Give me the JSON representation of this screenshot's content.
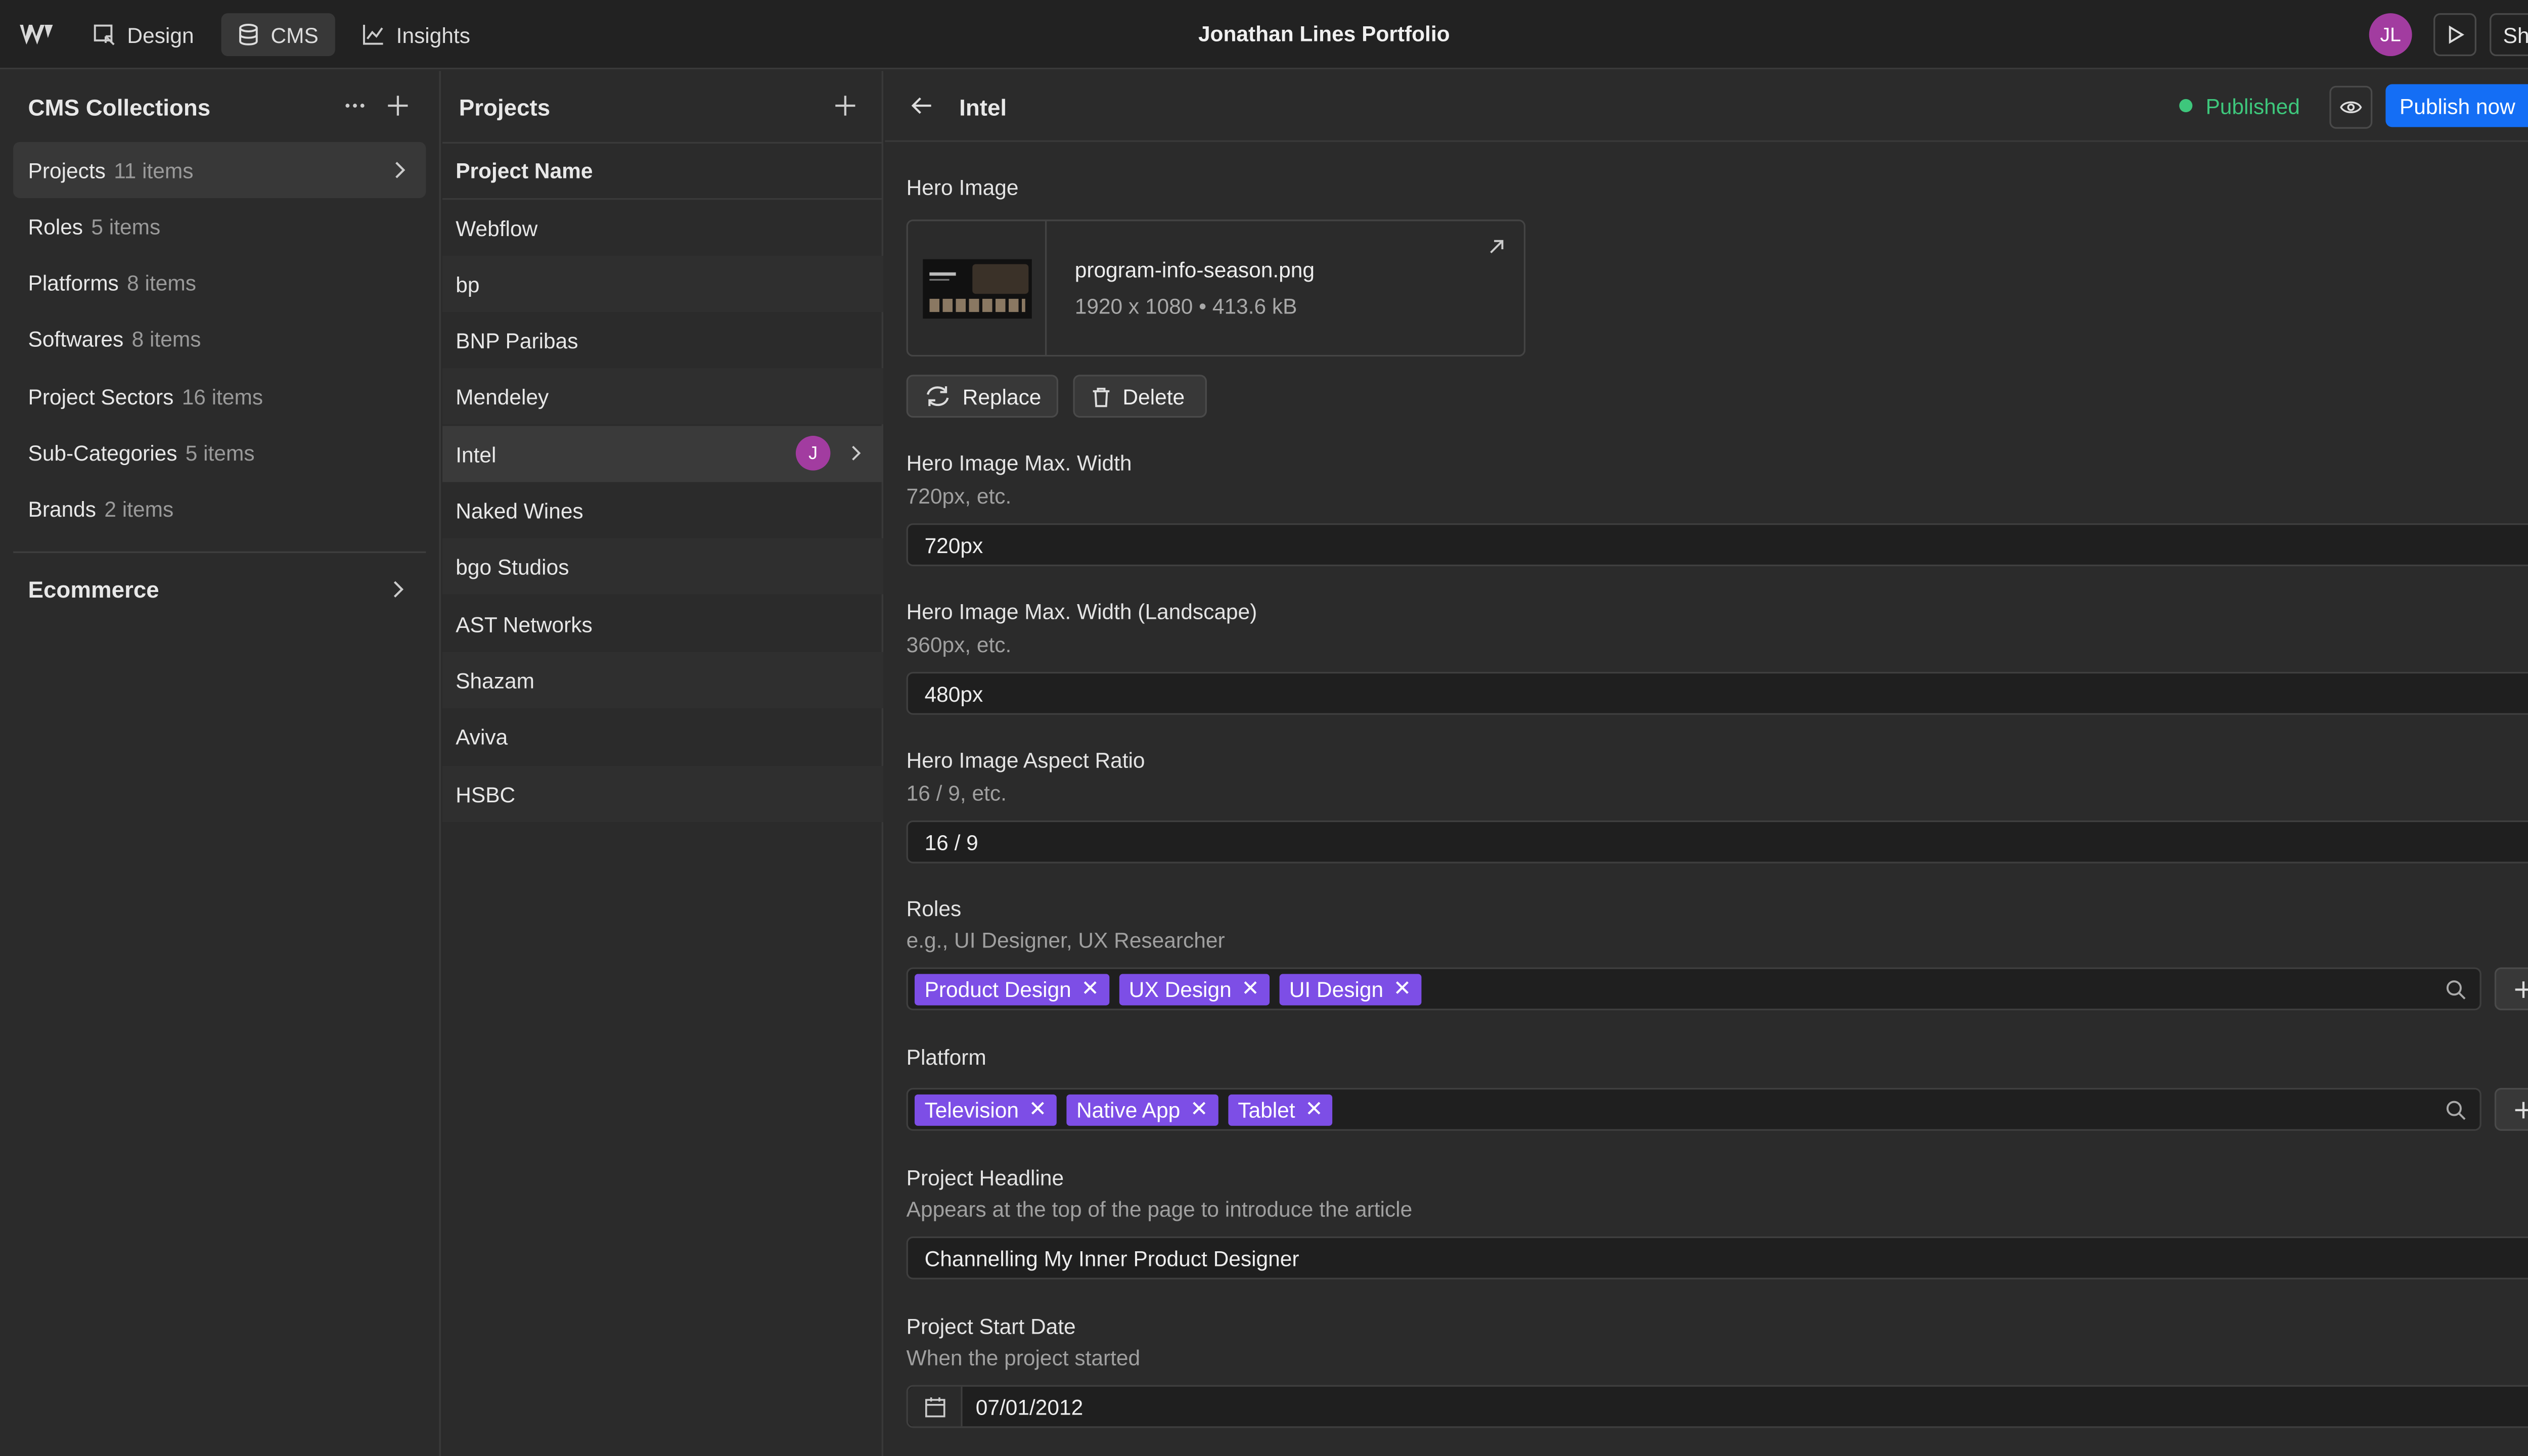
{
  "topbar": {
    "nav": [
      {
        "label": "Design",
        "icon": "design-icon"
      },
      {
        "label": "CMS",
        "icon": "database-icon",
        "active": true
      },
      {
        "label": "Insights",
        "icon": "chart-icon"
      }
    ],
    "project_title": "Jonathan Lines Portfolio",
    "avatar_initials": "JL",
    "share_label": "Share"
  },
  "sidebar": {
    "title": "CMS Collections",
    "items": [
      {
        "label": "Projects",
        "count": "11 items",
        "selected": true
      },
      {
        "label": "Roles",
        "count": "5 items"
      },
      {
        "label": "Platforms",
        "count": "8 items"
      },
      {
        "label": "Softwares",
        "count": "8 items"
      },
      {
        "label": "Project Sectors",
        "count": "16 items"
      },
      {
        "label": "Sub-Categories",
        "count": "5 items"
      },
      {
        "label": "Brands",
        "count": "2 items"
      }
    ],
    "ecommerce_label": "Ecommerce"
  },
  "list": {
    "title": "Projects",
    "column_header": "Project Name",
    "rows": [
      "Webflow",
      "bp",
      "BNP Paribas",
      "Mendeley",
      "Intel",
      "Naked Wines",
      "bgo Studios",
      "AST Networks",
      "Shazam",
      "Aviva",
      "HSBC"
    ],
    "selected_index": 4,
    "selected_avatar": "J"
  },
  "detail": {
    "title": "Intel",
    "status": "Published",
    "publish_label": "Publish now",
    "status_color": "#3ec77c",
    "accent_color": "#146ef5",
    "tag_color": "#7d4ee6",
    "hero_image": {
      "label": "Hero Image",
      "filename": "program-info-season.png",
      "meta": "1920 x 1080 • 413.6 kB",
      "replace_label": "Replace",
      "delete_label": "Delete"
    },
    "max_width": {
      "label": "Hero Image Max. Width",
      "hint": "720px, etc.",
      "value": "720px"
    },
    "max_width_landscape": {
      "label": "Hero Image Max. Width (Landscape)",
      "hint": "360px, etc.",
      "value": "480px"
    },
    "aspect_ratio": {
      "label": "Hero Image Aspect Ratio",
      "hint": "16 / 9, etc.",
      "value": "16 / 9"
    },
    "roles": {
      "label": "Roles",
      "hint": "e.g., UI Designer, UX Researcher",
      "tags": [
        "Product Design",
        "UX Design",
        "UI Design"
      ]
    },
    "platform": {
      "label": "Platform",
      "tags": [
        "Television",
        "Native App",
        "Tablet"
      ]
    },
    "headline": {
      "label": "Project Headline",
      "hint": "Appears at the top of the page to introduce the article",
      "value": "Channelling My Inner Product Designer"
    },
    "start_date": {
      "label": "Project Start Date",
      "hint": "When the project started",
      "value": "07/01/2012"
    }
  }
}
